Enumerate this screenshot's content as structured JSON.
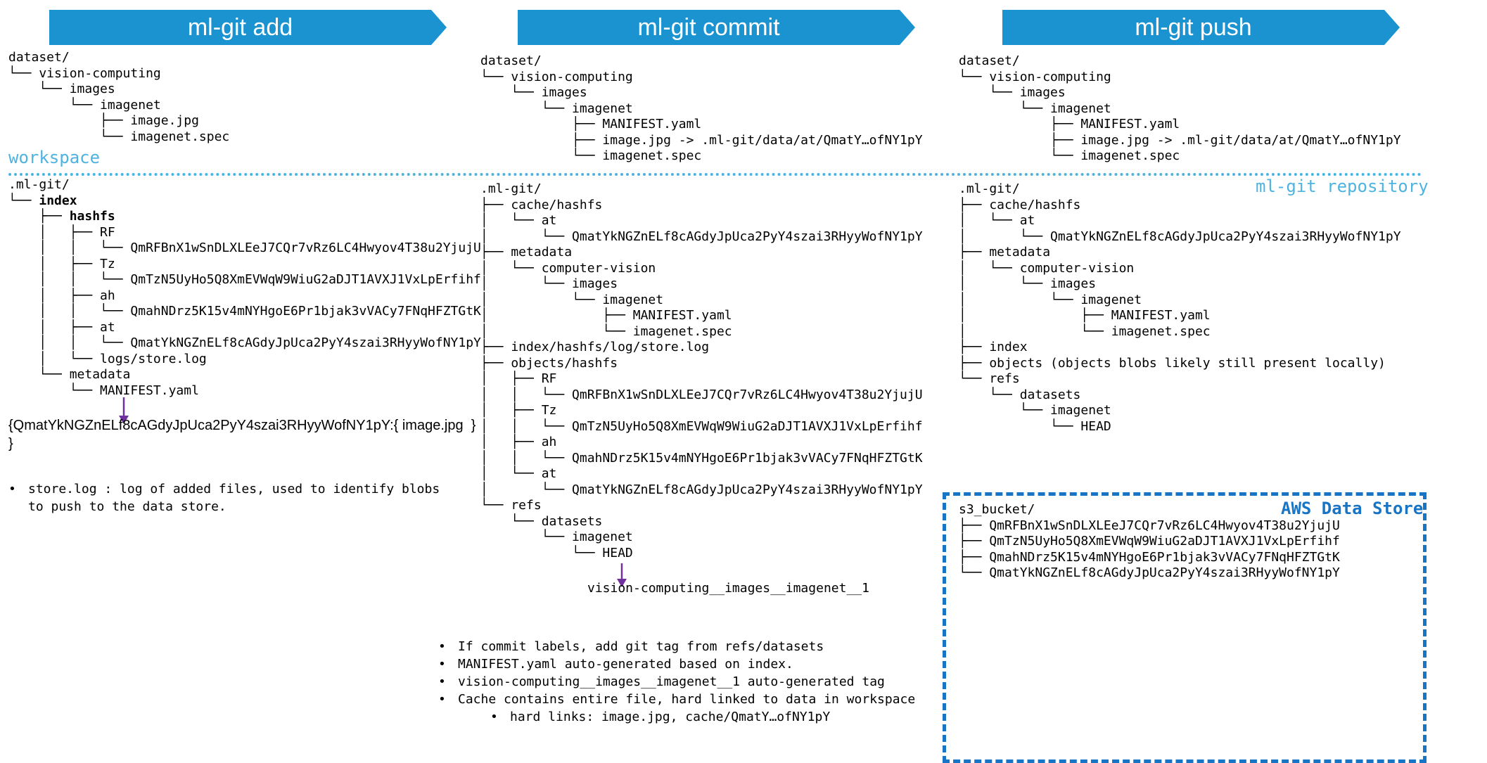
{
  "banners": {
    "add": "ml-git add",
    "commit": "ml-git commit",
    "push": "ml-git push"
  },
  "labels": {
    "workspace": "workspace",
    "repository": "ml-git repository",
    "aws": "AWS Data Store"
  },
  "add": {
    "workspace_tree": "dataset/\n└── vision-computing\n    └── images\n        └── imagenet\n            ├── image.jpg\n            └── imagenet.spec",
    "index_json_line1": "{QmatYkNGZnELf8cAGdyJpUca2PyY4szai3RHyyWofNY1pY:{ image.jpg  }",
    "index_json_line2": "}",
    "notes": [
      "store.log : log of added files, used to identify blobs\nto push to the data store."
    ]
  },
  "commit": {
    "workspace_tree": "dataset/\n└── vision-computing\n    └── images\n        └── imagenet\n            ├── MANIFEST.yaml\n            ├── image.jpg -> .ml-git/data/at/QmatY…ofNY1pY\n            └── imagenet.spec",
    "repo_tree": ".ml-git/\n├── cache/hashfs\n│   └── at\n│       └── QmatYkNGZnELf8cAGdyJpUca2PyY4szai3RHyyWofNY1pY\n├── metadata\n│   └── computer-vision\n│       └── images\n│           └── imagenet\n│               ├── MANIFEST.yaml\n│               └── imagenet.spec\n├── index/hashfs/log/store.log\n├── objects/hashfs\n│   ├── RF\n│   │   └── QmRFBnX1wSnDLXLEeJ7CQr7vRz6LC4Hwyov4T38u2YjujU\n│   ├── Tz\n│   │   └── QmTzN5UyHo5Q8XmEVWqW9WiuG2aDJT1AVXJ1VxLpErfihf\n│   ├── ah\n│   │   └── QmahNDrz5K15v4mNYHgoE6Pr1bjak3vVACy7FNqHFZTGtK\n│   └── at\n│       └── QmatYkNGZnELf8cAGdyJpUca2PyY4szai3RHyyWofNY1pY\n└── refs\n    └── datasets\n        └── imagenet\n            └── HEAD",
    "tag": "vision-computing__images__imagenet__1",
    "notes": [
      "If commit labels, add git tag from refs/datasets",
      "MANIFEST.yaml auto-generated based on index.",
      "vision-computing__images__imagenet__1 auto-generated tag",
      "Cache contains entire file, hard linked to data in workspace"
    ],
    "subnote": "hard links: image.jpg, cache/QmatY…ofNY1pY"
  },
  "push": {
    "workspace_tree": "dataset/\n└── vision-computing\n    └── images\n        └── imagenet\n            ├── MANIFEST.yaml\n            ├── image.jpg -> .ml-git/data/at/QmatY…ofNY1pY\n            └── imagenet.spec",
    "repo_tree": ".ml-git/\n├── cache/hashfs\n│   └── at\n│       └── QmatYkNGZnELf8cAGdyJpUca2PyY4szai3RHyyWofNY1pY\n├── metadata\n│   └── computer-vision\n│       └── images\n│           └── imagenet\n│               ├── MANIFEST.yaml\n│               └── imagenet.spec\n├── index\n├── objects (objects blobs likely still present locally)\n└── refs\n    └── datasets\n        └── imagenet\n            └── HEAD",
    "s3_tree": "s3_bucket/\n├── QmRFBnX1wSnDLXLEeJ7CQr7vRz6LC4Hwyov4T38u2YjujU\n├── QmTzN5UyHo5Q8XmEVWqW9WiuG2aDJT1AVXJ1VxLpErfihf\n├── QmahNDrz5K15v4mNYHgoE6Pr1bjak3vVACy7FNqHFZTGtK\n└── QmatYkNGZnELf8cAGdyJpUca2PyY4szai3RHyyWofNY1pY"
  },
  "colors": {
    "banner": "#1a93d0",
    "label": "#4fb3e0",
    "aws": "#1874c4",
    "arrow": "#7030a0"
  }
}
